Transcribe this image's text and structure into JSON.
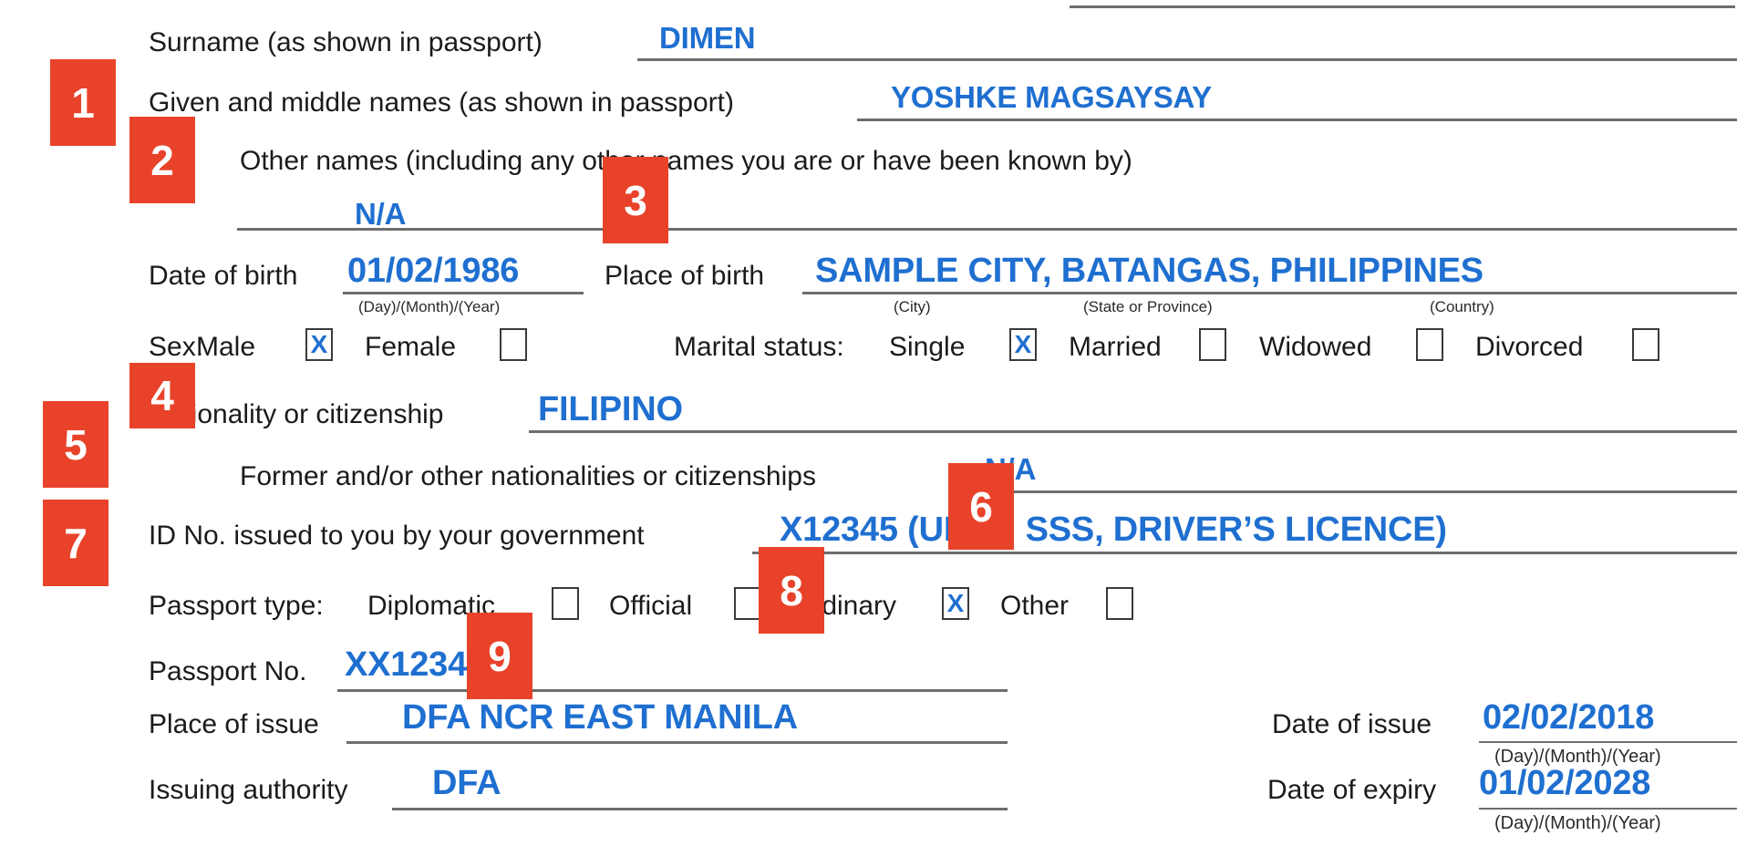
{
  "document": {
    "type": "visa-application-personal-details-form",
    "ink_color": "#1f6fd0",
    "callout_color": "#e8432a"
  },
  "fields": {
    "surname": {
      "label": "Surname (as shown in passport)",
      "value": "DIMEN"
    },
    "given_middle_names": {
      "label": "Given and middle names (as shown in passport)",
      "value": "YOSHKE   MAGSAYSAY"
    },
    "other_names": {
      "label": "Other names (including any other names you are or have been known by)",
      "value": "N/A"
    },
    "date_of_birth": {
      "label": "Date of birth",
      "value": "01/02/1986",
      "sublabel": "(Day)/(Month)/(Year)"
    },
    "place_of_birth": {
      "label": "Place of birth",
      "value": "SAMPLE CITY, BATANGAS, PHILIPPINES",
      "sublabels": [
        "(City)",
        "(State or Province)",
        "(Country)"
      ]
    },
    "sex": {
      "label": "Sex:",
      "options": [
        {
          "label": "Male",
          "checked": true
        },
        {
          "label": "Female",
          "checked": false
        }
      ]
    },
    "marital_status": {
      "label": "Marital status:",
      "options": [
        {
          "label": "Single",
          "checked": true
        },
        {
          "label": "Married",
          "checked": false
        },
        {
          "label": "Widowed",
          "checked": false
        },
        {
          "label": "Divorced",
          "checked": false
        }
      ]
    },
    "nationality": {
      "label": "Nationality or citizenship",
      "value": "FILIPINO"
    },
    "former_nationalities": {
      "label": "Former and/or other nationalities or citizenships",
      "value": "N/A"
    },
    "government_id": {
      "label": "ID No. issued to you by your government",
      "value": "X12345 (UMID, SSS, DRIVER’S LICENCE)"
    },
    "passport_type": {
      "label": "Passport type:",
      "options": [
        {
          "label": "Diplomatic",
          "checked": false
        },
        {
          "label": "Official",
          "checked": false
        },
        {
          "label": "Ordinary",
          "checked": true
        },
        {
          "label": "Other",
          "checked": false
        }
      ]
    },
    "passport_no": {
      "label": "Passport No.",
      "value": "XX1234567"
    },
    "place_of_issue": {
      "label": "Place of issue",
      "value": "DFA NCR EAST MANILA"
    },
    "date_of_issue": {
      "label": "Date of issue",
      "value": "02/02/2018",
      "sublabel": "(Day)/(Month)/(Year)"
    },
    "issuing_authority": {
      "label": "Issuing authority",
      "value": "DFA"
    },
    "date_of_expiry": {
      "label": "Date of expiry",
      "value": "01/02/2028",
      "sublabel": "(Day)/(Month)/(Year)"
    }
  },
  "checkbox_mark": "X",
  "callouts": [
    {
      "number": "1"
    },
    {
      "number": "2"
    },
    {
      "number": "3"
    },
    {
      "number": "4"
    },
    {
      "number": "5"
    },
    {
      "number": "6"
    },
    {
      "number": "7"
    },
    {
      "number": "8"
    },
    {
      "number": "9"
    }
  ]
}
